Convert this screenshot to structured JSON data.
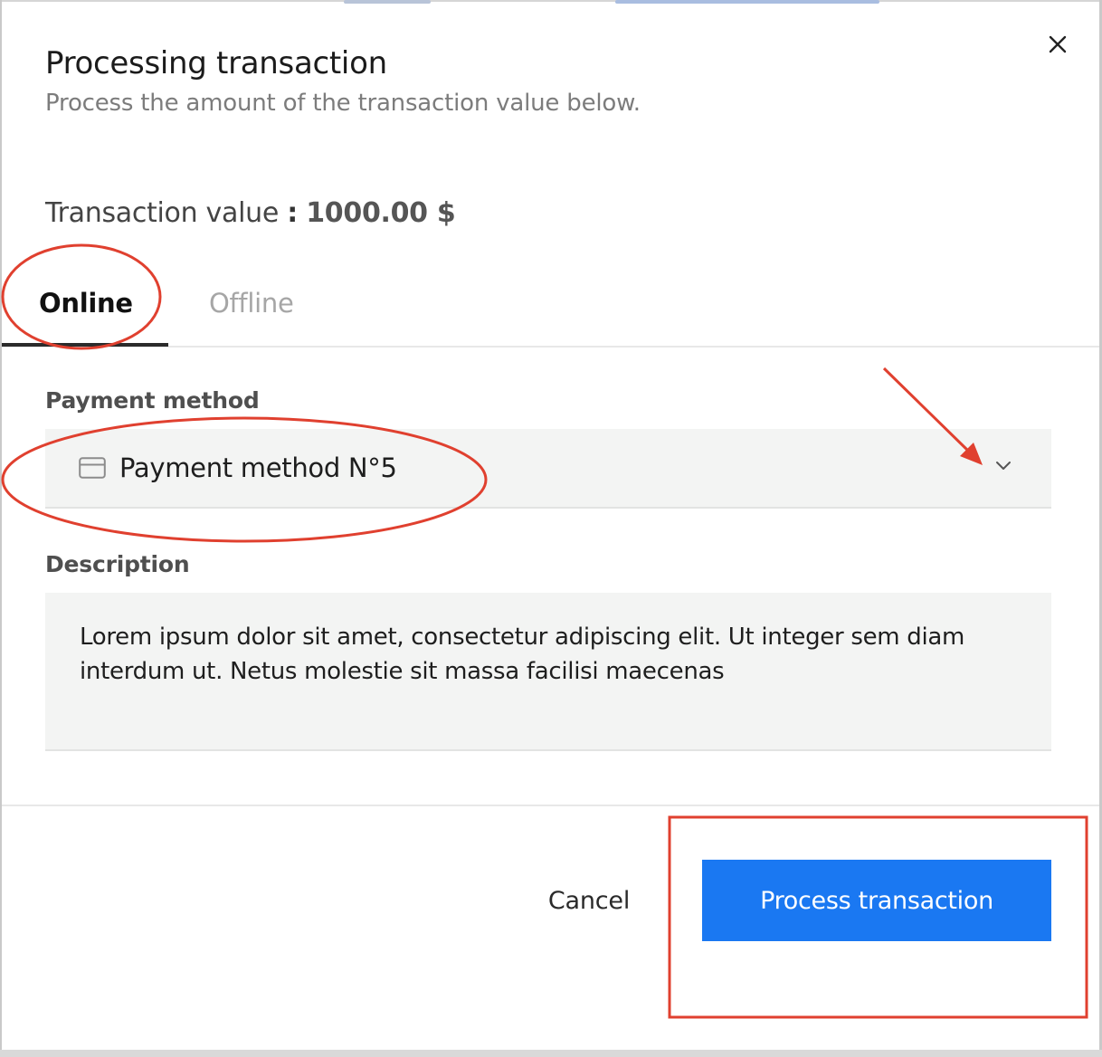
{
  "dialog": {
    "title": "Processing transaction",
    "subtitle": "Process the amount of the transaction value below.",
    "close_icon": "close-icon"
  },
  "transaction": {
    "label": "Transaction value",
    "separator": ":",
    "value": "1000.00 $"
  },
  "tabs": [
    {
      "label": "Online",
      "active": true
    },
    {
      "label": "Offline",
      "active": false
    }
  ],
  "payment": {
    "label": "Payment method",
    "selected": "Payment method N°5",
    "icon": "credit-card-icon",
    "dropdown_icon": "chevron-down-icon"
  },
  "description": {
    "label": "Description",
    "value": "Lorem ipsum dolor sit amet, consectetur adipiscing elit. Ut integer sem diam interdum ut. Netus molestie sit massa facilisi maecenas"
  },
  "footer": {
    "cancel_label": "Cancel",
    "submit_label": "Process transaction"
  },
  "colors": {
    "primary": "#1a78f2",
    "annotation": "#e0402f",
    "field_background": "#f3f4f3"
  }
}
